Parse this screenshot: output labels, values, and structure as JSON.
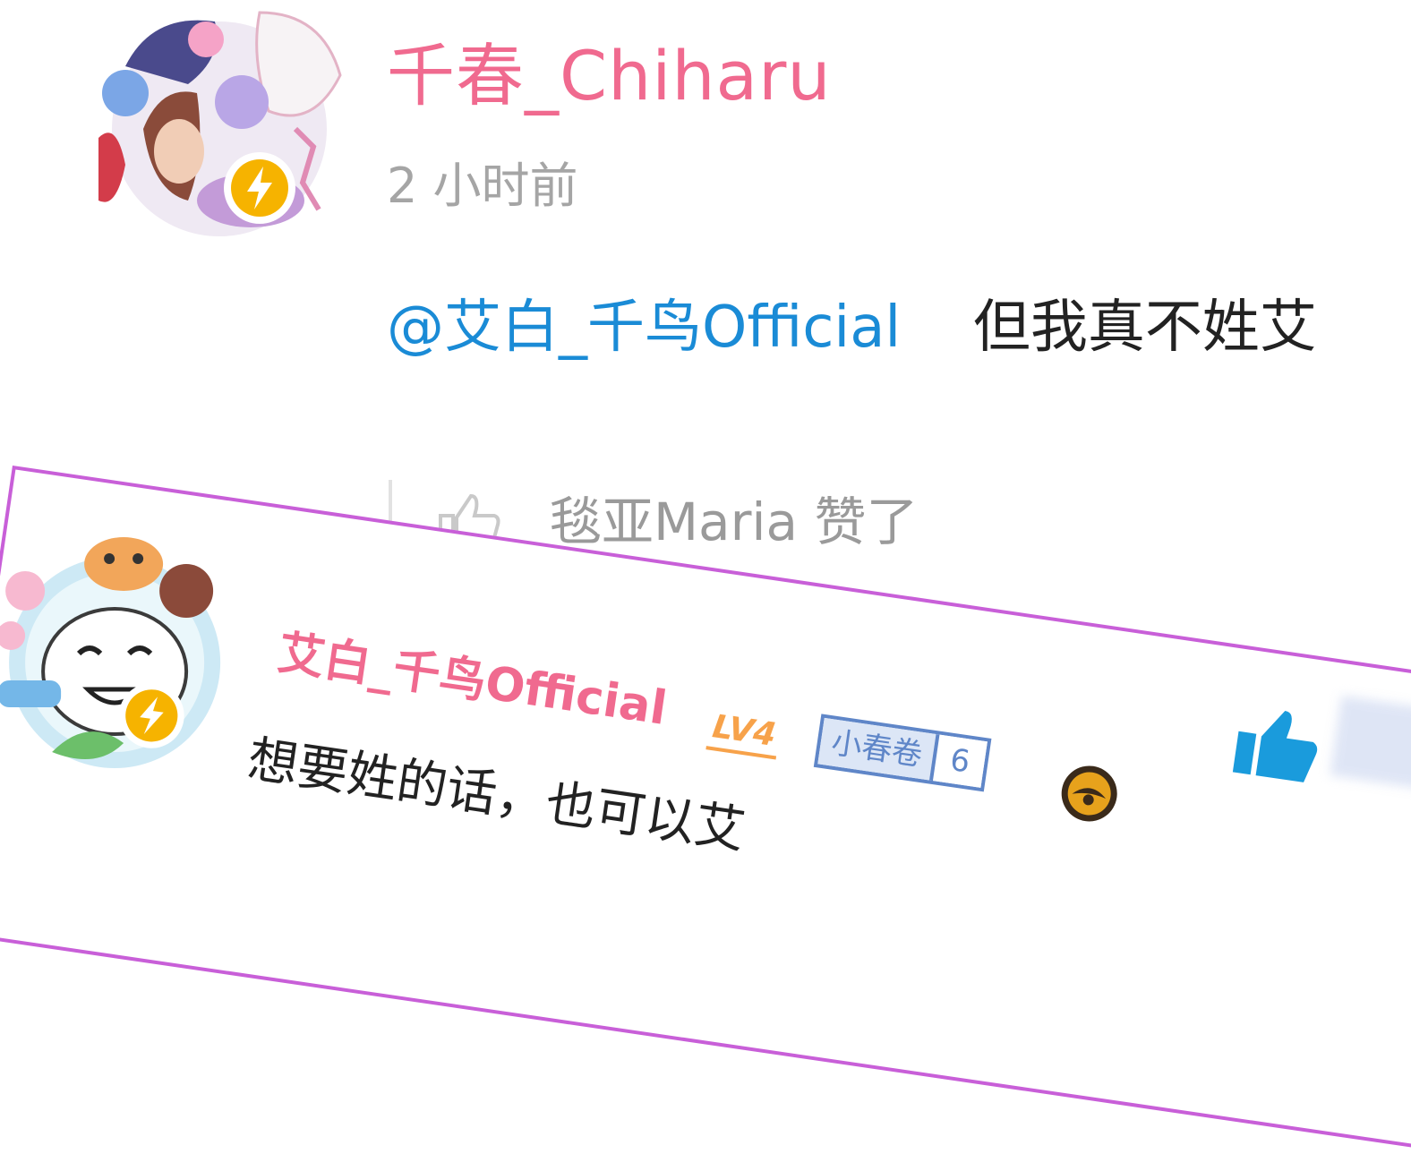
{
  "top_comment": {
    "username": "千春_Chiharu",
    "time": "2 小时前",
    "mention": "@艾白_千鸟Official",
    "text": "但我真不姓艾",
    "liked_by": "毯亚Maria 赞了"
  },
  "reply": {
    "username": "艾白_千鸟Official",
    "level": "LV4",
    "medal_name": "小春卷",
    "medal_level": "6",
    "text": "想要姓的话，也可以艾"
  },
  "colors": {
    "username": "#f06a8f",
    "mention": "#1a8bd6",
    "time": "#a5a5a5",
    "highlight_border": "#c85fd8",
    "medal": "#5f86c8",
    "level": "#f7a24a",
    "like_active": "#1a9bdc"
  },
  "icons": [
    "verified-lightning-icon",
    "thumb-up-icon",
    "medal-badge",
    "hat-icon"
  ]
}
